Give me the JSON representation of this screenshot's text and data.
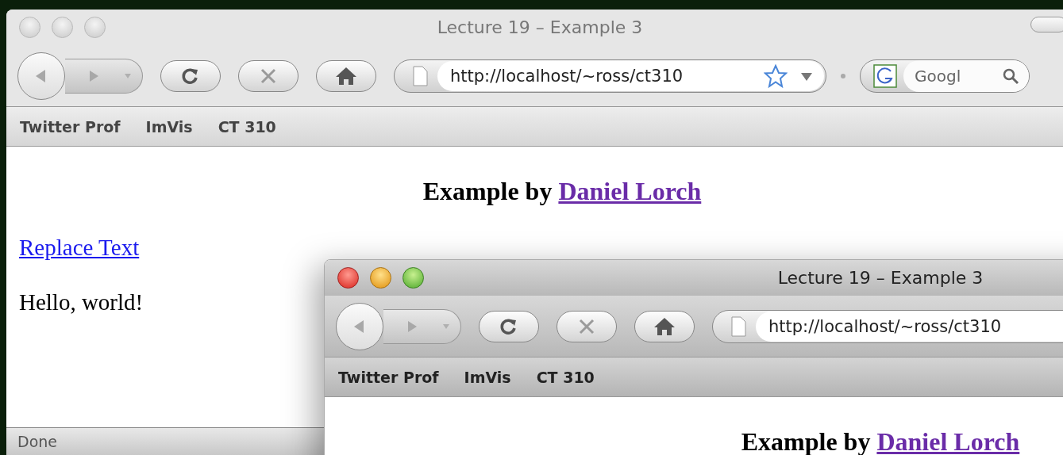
{
  "windows": [
    {
      "title": "Lecture 19 – Example 3",
      "active": false,
      "url": "http://localhost/~ross/ct310",
      "search_placeholder": "Googl",
      "bookmarks": [
        "Twitter Prof",
        "ImVis",
        "CT 310"
      ],
      "page": {
        "heading": "Example by ",
        "heading_link": "Daniel Lorch",
        "link": "Replace Text",
        "text": "Hello, world!"
      },
      "status": "Done"
    },
    {
      "title": "Lecture 19 – Example 3",
      "active": true,
      "url": "http://localhost/~ross/ct310",
      "bookmarks": [
        "Twitter Prof",
        "ImVis",
        "CT 310"
      ],
      "page": {
        "heading": "Example by ",
        "heading_link": "Daniel Lorch"
      }
    }
  ]
}
